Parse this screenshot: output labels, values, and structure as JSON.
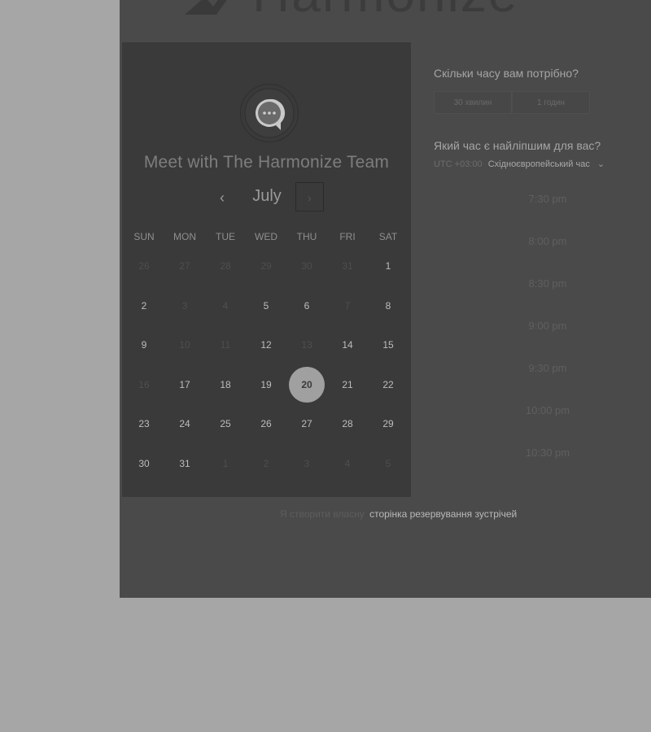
{
  "brand": {
    "name": "Harmonize",
    "logo_icon": "harmonize-logo-icon"
  },
  "colors": {
    "page_bg": "#a6a6a6",
    "panel_bg": "#4a4a4a",
    "calendar_bg": "#3a3a3a",
    "selected_day_bg": "#a0a0a0"
  },
  "calendar": {
    "title": "Meet with The Harmonize Team",
    "avatar_icon": "chat-bubble-icon",
    "month": "July",
    "prev_icon": "chevron-left-icon",
    "next_icon": "chevron-right-icon",
    "weekdays": [
      "SUN",
      "MON",
      "TUE",
      "WED",
      "THU",
      "FRI",
      "SAT"
    ],
    "selected_day": "20",
    "weeks": [
      [
        {
          "d": "26",
          "muted": true
        },
        {
          "d": "27",
          "muted": true
        },
        {
          "d": "28",
          "muted": true
        },
        {
          "d": "29",
          "muted": true
        },
        {
          "d": "30",
          "muted": true
        },
        {
          "d": "31",
          "muted": true
        },
        {
          "d": "1",
          "muted": false
        }
      ],
      [
        {
          "d": "2",
          "muted": false
        },
        {
          "d": "3",
          "muted": true
        },
        {
          "d": "4",
          "muted": true
        },
        {
          "d": "5",
          "muted": false
        },
        {
          "d": "6",
          "muted": false
        },
        {
          "d": "7",
          "muted": true
        },
        {
          "d": "8",
          "muted": false
        }
      ],
      [
        {
          "d": "9",
          "muted": false
        },
        {
          "d": "10",
          "muted": true
        },
        {
          "d": "11",
          "muted": true
        },
        {
          "d": "12",
          "muted": false
        },
        {
          "d": "13",
          "muted": true
        },
        {
          "d": "14",
          "muted": false
        },
        {
          "d": "15",
          "muted": false
        }
      ],
      [
        {
          "d": "16",
          "muted": true
        },
        {
          "d": "17",
          "muted": false
        },
        {
          "d": "18",
          "muted": false
        },
        {
          "d": "19",
          "muted": false
        },
        {
          "d": "20",
          "muted": false
        },
        {
          "d": "21",
          "muted": false
        },
        {
          "d": "22",
          "muted": false
        }
      ],
      [
        {
          "d": "23",
          "muted": false
        },
        {
          "d": "24",
          "muted": false
        },
        {
          "d": "25",
          "muted": false
        },
        {
          "d": "26",
          "muted": false
        },
        {
          "d": "27",
          "muted": false
        },
        {
          "d": "28",
          "muted": false
        },
        {
          "d": "29",
          "muted": false
        }
      ],
      [
        {
          "d": "30",
          "muted": false
        },
        {
          "d": "31",
          "muted": false
        },
        {
          "d": "1",
          "muted": true
        },
        {
          "d": "2",
          "muted": true
        },
        {
          "d": "3",
          "muted": true
        },
        {
          "d": "4",
          "muted": true
        },
        {
          "d": "5",
          "muted": true
        }
      ]
    ]
  },
  "booking": {
    "duration_question": "Скільки часу вам потрібно?",
    "durations": [
      "30 хвилин",
      "1 годин"
    ],
    "time_question": "Який час є найліпшим для вас?",
    "timezone_offset": "UTC +03:00",
    "timezone_name": "Східноєвропейський час",
    "timezone_caret_icon": "chevron-down-icon",
    "slots": [
      "7:30 pm",
      "8:00 pm",
      "8:30 pm",
      "9:00 pm",
      "9:30 pm",
      "10:00 pm",
      "10:30 pm"
    ]
  },
  "footer": {
    "prefix": "Я створити власну",
    "link": "сторінка резервування зустрічей"
  }
}
